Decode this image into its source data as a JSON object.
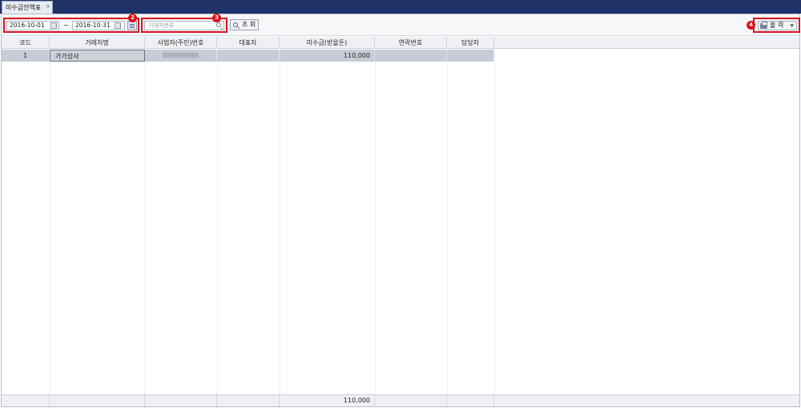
{
  "tab": {
    "label": "미수금잔액표",
    "close": "×"
  },
  "toolbar": {
    "date_from": "2016-10-01",
    "date_to": "2016-10-31",
    "tilde": "~",
    "search_placeholder": "거래처분류",
    "query_label": "조 회",
    "print_label": "출 력",
    "print_arrow": "▼"
  },
  "badges": [
    "2",
    "3",
    "4"
  ],
  "table": {
    "columns": [
      "코드",
      "거래처명",
      "사업자(주민)번호",
      "대표자",
      "미수금(받을돈)",
      "연락번호",
      "담당자"
    ],
    "rows": [
      {
        "code": "1",
        "name": "가가상사",
        "biz_no": "",
        "ceo": "",
        "receivable": "110,000",
        "phone": "",
        "manager": ""
      }
    ],
    "footer_total": "110,000"
  },
  "colors": {
    "titlebar": "#1f3368",
    "highlight_border": "#d9121d",
    "badge": "#d9121d",
    "row_selected": "#c8ccd6"
  }
}
